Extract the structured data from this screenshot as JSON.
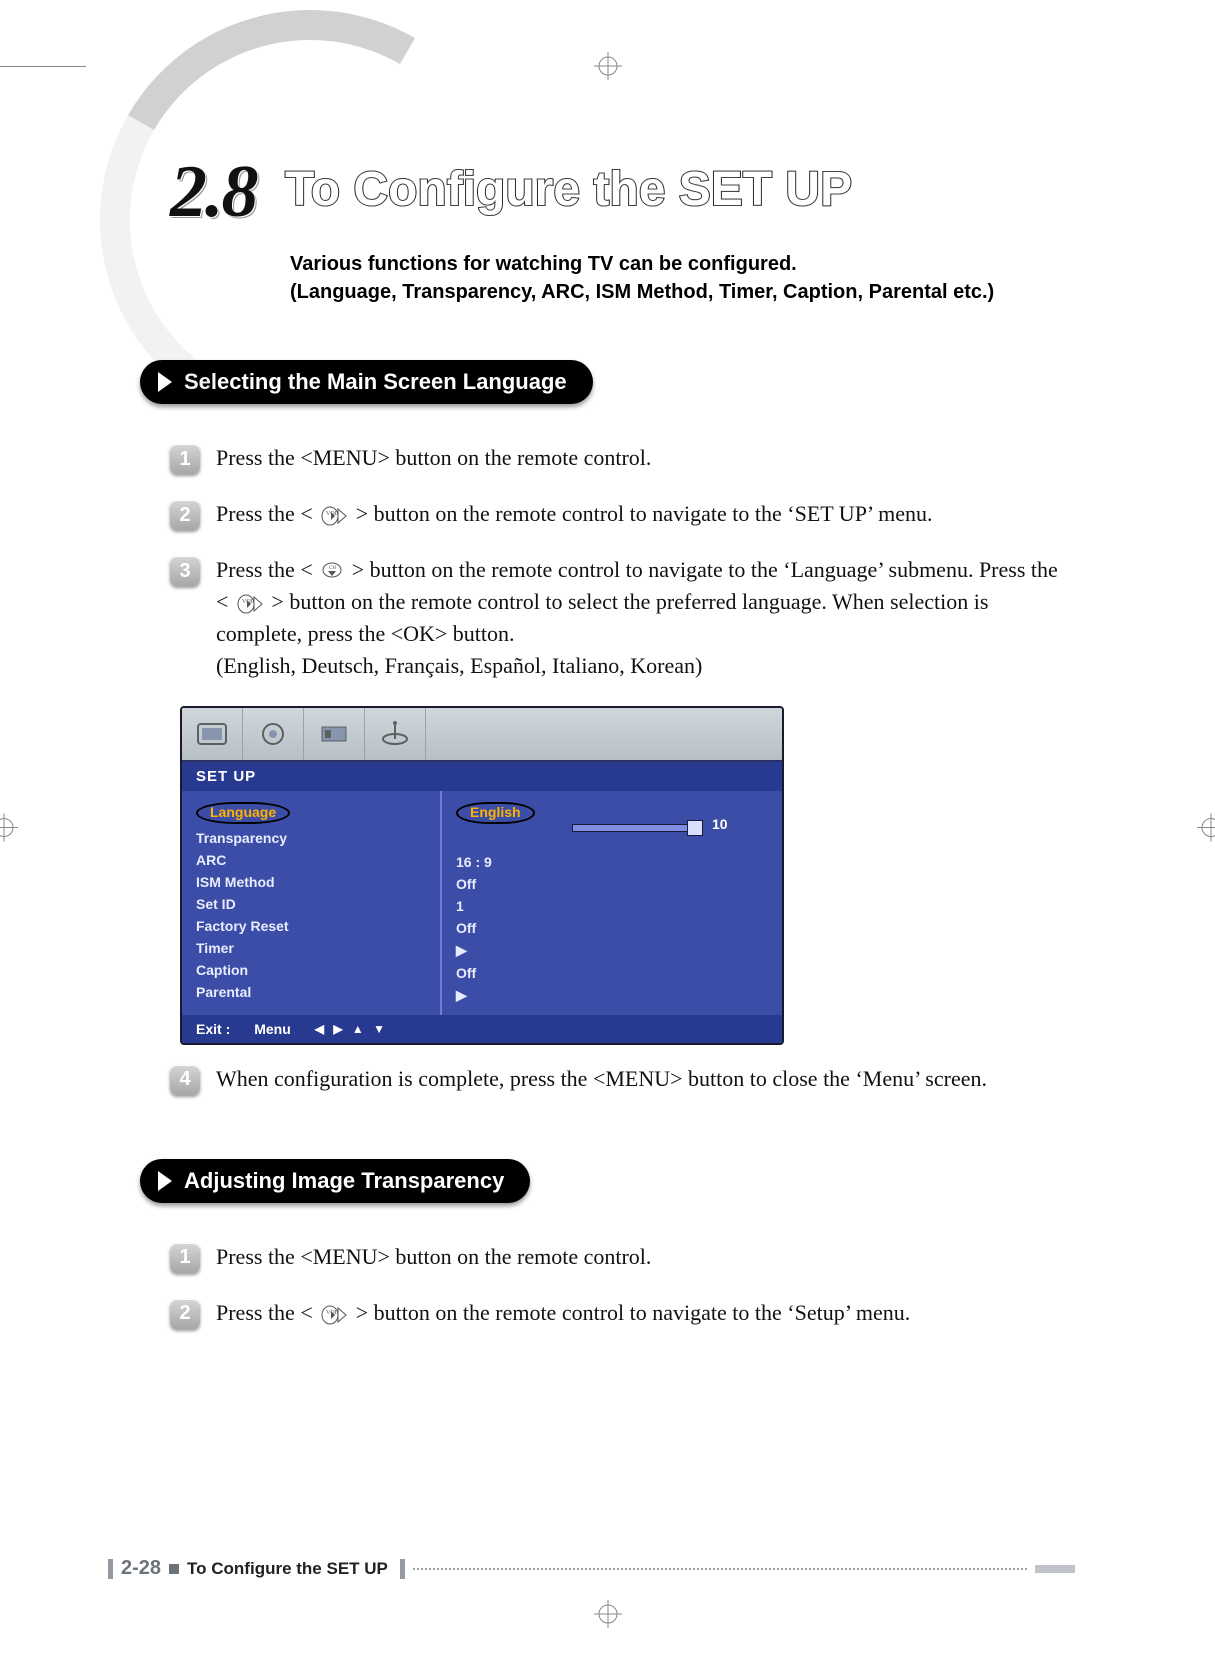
{
  "header": {
    "section_number": "2.8",
    "title": "To Configure the SET UP",
    "intro_line1": "Various functions for watching TV can be configured.",
    "intro_line2": "(Language, Transparency, ARC, ISM Method, Timer, Caption, Parental etc.)"
  },
  "subheads": {
    "s1": "Selecting the Main Screen Language",
    "s2": "Adjusting Image Transparency"
  },
  "steps1": {
    "n1": "1",
    "t1": "Press the <MENU> button on the remote control.",
    "n2": "2",
    "t2a": "Press the < ",
    "t2b": " > button on the remote control to navigate to the ‘SET UP’ menu.",
    "n3": "3",
    "t3a": "Press the < ",
    "t3b": " > button on the remote control to navigate to the ‘Language’ submenu. Press the < ",
    "t3c": " > button on the remote control to select the preferred language. When selection is complete, press the <OK> button.",
    "t3d": "(English, Deutsch, Français, Español, Italiano, Korean)",
    "n4": "4",
    "t4": "When configuration is complete, press the <MENU> button to close the ‘Menu’ screen."
  },
  "steps2": {
    "n1": "1",
    "t1": "Press the <MENU> button on the remote control.",
    "n2": "2",
    "t2a": "Press the < ",
    "t2b": " > button on the remote control to navigate to the ‘Setup’ menu."
  },
  "osd": {
    "title": "SET UP",
    "left": {
      "r0": "Language",
      "r1": "Transparency",
      "r2": "ARC",
      "r3": "ISM Method",
      "r4": "Set ID",
      "r5": "Factory Reset",
      "r6": "Timer",
      "r7": "Caption",
      "r8": "Parental"
    },
    "right": {
      "r0": "English",
      "r1_val": "10",
      "r2": "16 : 9",
      "r3": "Off",
      "r4": "1",
      "r5": "Off",
      "r6": "▶",
      "r7": "Off",
      "r8": "▶"
    },
    "footer_exit": "Exit :",
    "footer_menu": "Menu",
    "footer_nav": "◀ ▶ ▲ ▼"
  },
  "footer": {
    "page": "2-28",
    "label": "To Configure the SET UP"
  }
}
